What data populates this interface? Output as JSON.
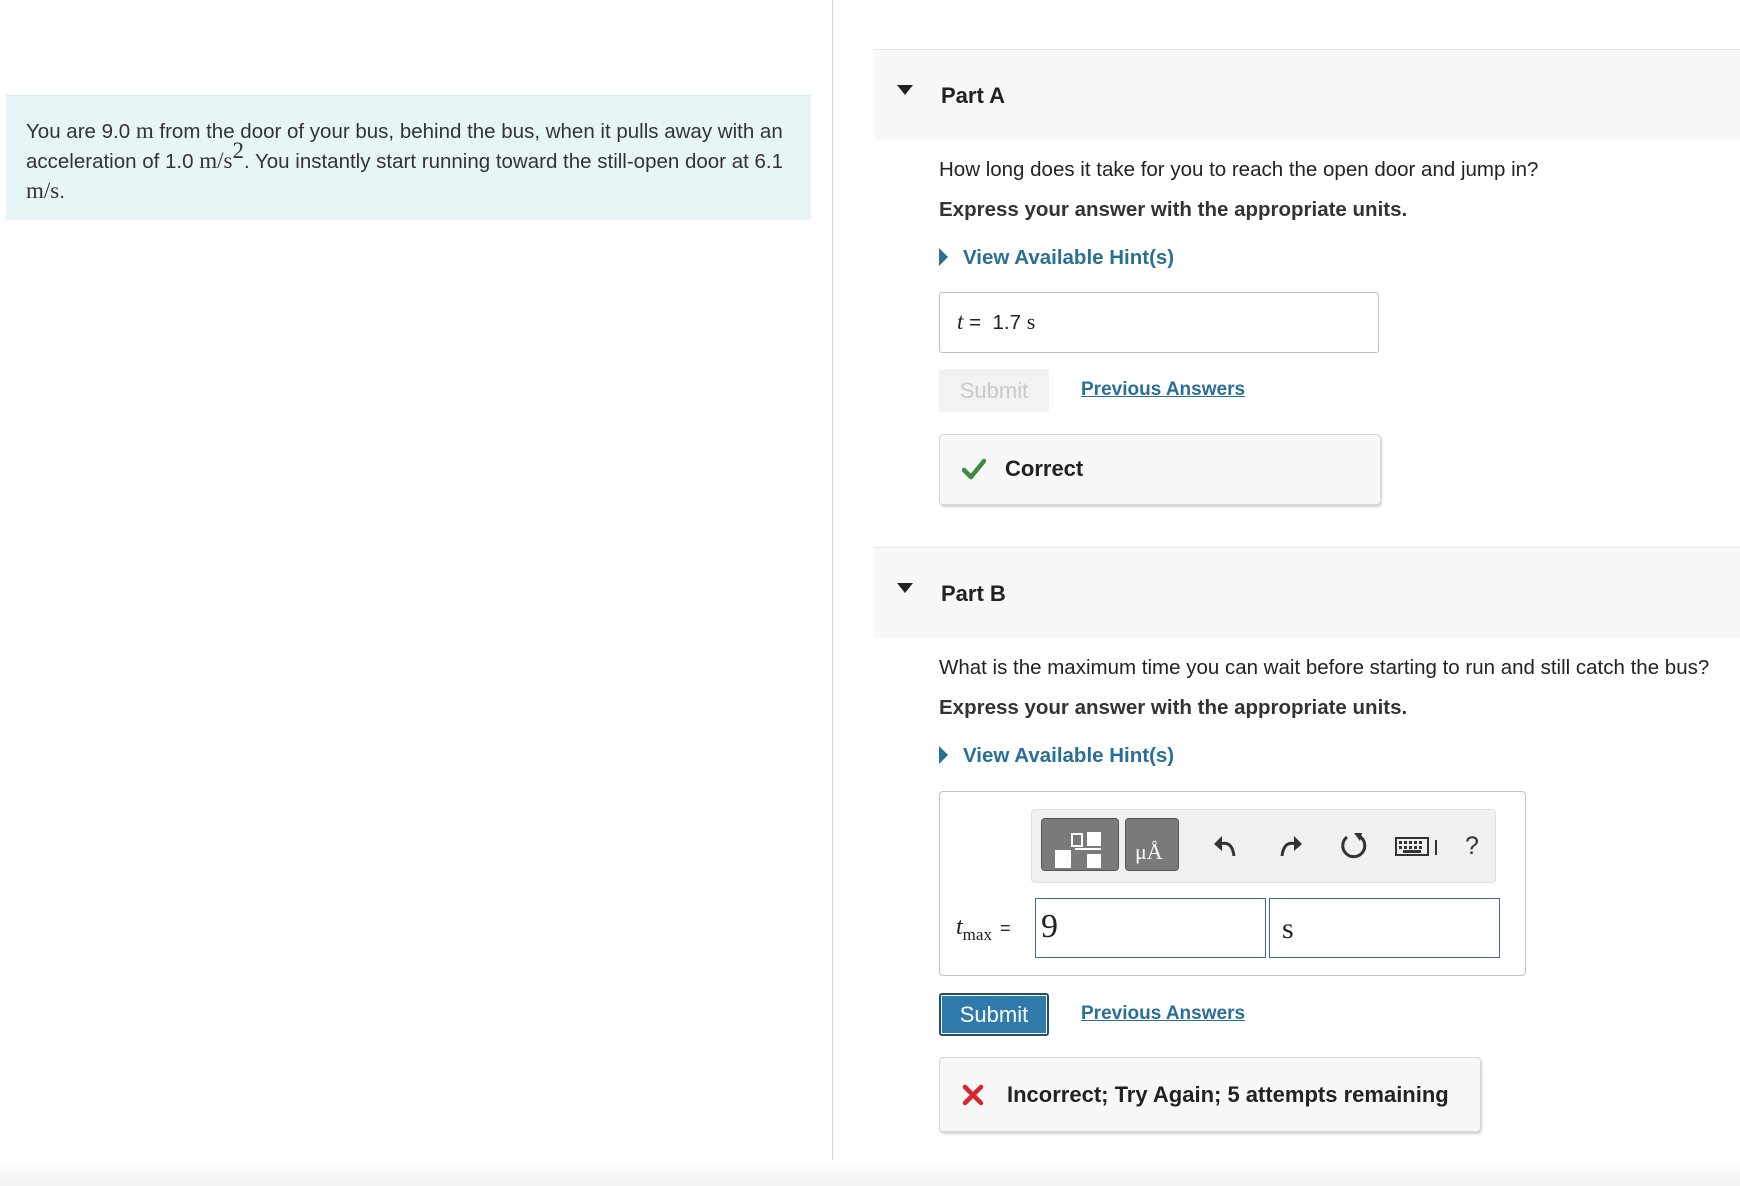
{
  "problem": {
    "segments": [
      "You are 9.0 ",
      "m",
      " from the door of your bus, behind the bus, when it pulls away with an acceleration of 1.0 ",
      "m/s",
      "2",
      ". You instantly start running toward the still-open door at 6.1 ",
      "m/s",
      "."
    ]
  },
  "partA": {
    "title": "Part A",
    "question": "How long does it take for you to reach the open door and jump in?",
    "instruction": "Express your answer with the appropriate units.",
    "hint_label": "View Available Hint(s)",
    "answer": {
      "variable": "t",
      "equals": "=",
      "value": "1.7",
      "unit": "s"
    },
    "submit_label": "Submit",
    "previous_answers_label": "Previous Answers",
    "feedback": "Correct"
  },
  "partB": {
    "title": "Part B",
    "question": "What is the maximum time you can wait before starting to run and still catch the bus?",
    "instruction": "Express your answer with the appropriate units.",
    "hint_label": "View Available Hint(s)",
    "label_var": "t",
    "label_sub": "max",
    "label_eq": "=",
    "value_input": "9",
    "unit_input": "s",
    "submit_label": "Submit",
    "previous_answers_label": "Previous Answers",
    "feedback": "Incorrect; Try Again; 5 attempts remaining",
    "toolbar": {
      "symbols_text": "μÅ",
      "help_label": "?",
      "icons": [
        "templates-icon",
        "symbols-icon",
        "undo-icon",
        "redo-icon",
        "reset-icon",
        "keyboard-icon",
        "help-icon"
      ]
    }
  },
  "colors": {
    "link": "#2a6f95",
    "submit": "#2e7bab",
    "correct": "#3d8b3d",
    "incorrect": "#d9262b",
    "problem_bg": "#e8f5f7"
  }
}
